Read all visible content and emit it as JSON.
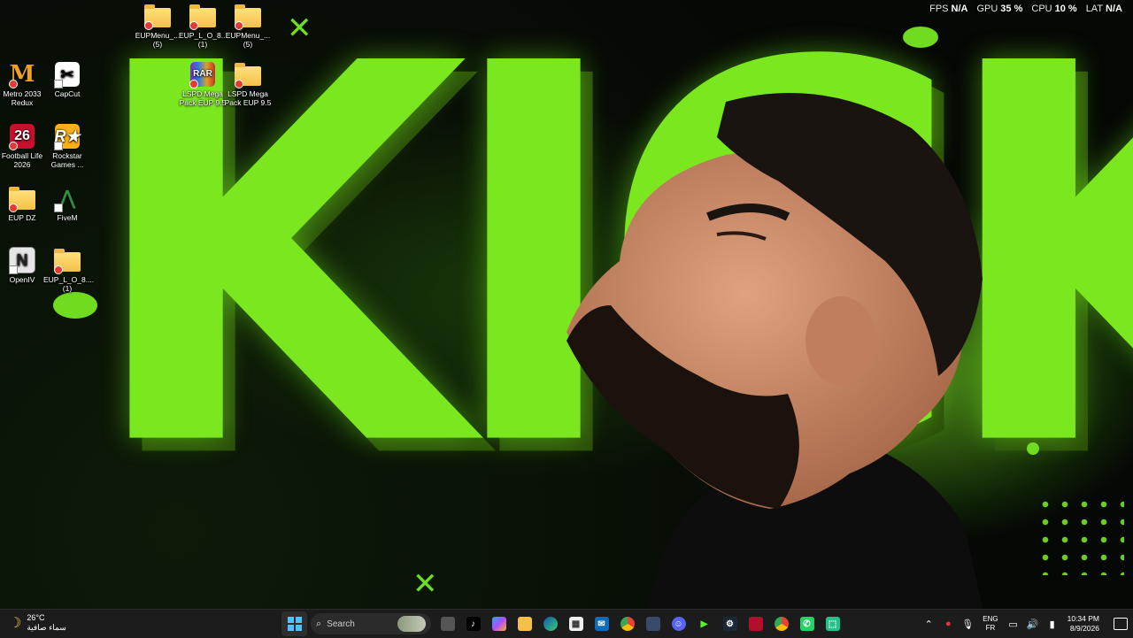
{
  "overlay": {
    "fps_label": "FPS",
    "fps_value": "N/A",
    "gpu_label": "GPU",
    "gpu_value": "35 %",
    "cpu_label": "CPU",
    "cpu_value": "10 %",
    "lat_label": "LAT",
    "lat_value": "N/A"
  },
  "wallpaper": {
    "word": "KICK",
    "accent": "#7be81f"
  },
  "desktop": {
    "icons": [
      {
        "label": "EUPMenu_... (5)",
        "icon": "folder-icon"
      },
      {
        "label": "EUP_L_O_8.... (1)",
        "icon": "folder-icon"
      },
      {
        "label": "EUPMenu_... (5)",
        "icon": "folder-icon"
      },
      {
        "label": "Metro 2033 Redux",
        "icon": "metro-icon"
      },
      {
        "label": "CapCut",
        "icon": "capcut-icon"
      },
      {
        "label": "LSPD Mega Pack EUP 9.5",
        "icon": "winrar-icon"
      },
      {
        "label": "LSPD Mega Pack EUP 9.5",
        "icon": "folder-icon"
      },
      {
        "label": "Football Life 2026",
        "icon": "football-life-icon"
      },
      {
        "label": "Rockstar Games ...",
        "icon": "rockstar-icon"
      },
      {
        "label": "EUP DZ",
        "icon": "folder-icon"
      },
      {
        "label": "FiveM",
        "icon": "fivem-icon"
      },
      {
        "label": "OpenIV",
        "icon": "openiv-icon"
      },
      {
        "label": "EUP_L_O_8.... (1)",
        "icon": "folder-icon"
      }
    ]
  },
  "taskbar": {
    "weather": {
      "temp": "26°C",
      "condition": "سماء صافية"
    },
    "search_placeholder": "Search",
    "apps": [
      "task-view-icon",
      "tiktok-icon",
      "copilot-icon",
      "file-explorer-icon",
      "edge-icon",
      "store-icon",
      "outlook-icon",
      "chrome-icon",
      "app-icon",
      "discord-icon",
      "kick-icon",
      "steam-icon",
      "app-icon",
      "chrome-icon",
      "whatsapp-icon",
      "app-icon"
    ],
    "tray": {
      "lang_top": "ENG",
      "lang_bottom": "FR",
      "time": "10:34 PM",
      "date": "8/9/2026"
    }
  }
}
